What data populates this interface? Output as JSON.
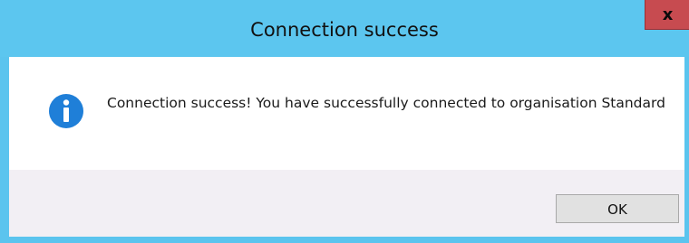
{
  "dialog": {
    "title": "Connection success",
    "close_label": "x",
    "message": "Connection success! You have successfully connected to organisation Standard",
    "ok_label": "OK",
    "icon": "info-icon"
  },
  "colors": {
    "titlebar": "#5cc6ef",
    "close_button": "#c74b50",
    "content_bg": "#ffffff",
    "footer_bg": "#f2eff4",
    "info_icon": "#1f7fd8"
  }
}
